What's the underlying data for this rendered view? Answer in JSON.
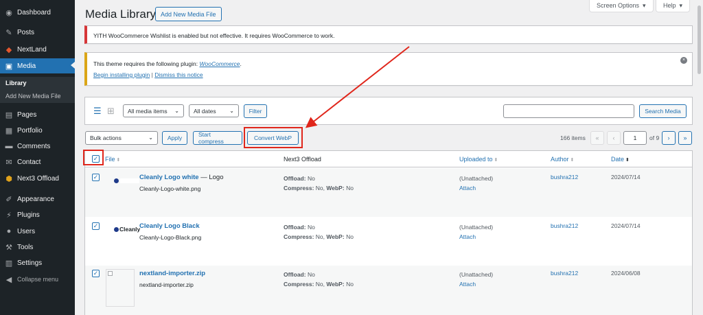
{
  "sidebar": {
    "items": [
      {
        "label": "Dashboard",
        "icon": "dashboard-icon"
      },
      {
        "label": "Posts",
        "icon": "pin-icon"
      },
      {
        "label": "NextLand",
        "icon": "nextland-icon"
      },
      {
        "label": "Media",
        "icon": "media-icon"
      },
      {
        "label": "Pages",
        "icon": "pages-icon"
      },
      {
        "label": "Portfolio",
        "icon": "portfolio-icon"
      },
      {
        "label": "Comments",
        "icon": "comments-icon"
      },
      {
        "label": "Contact",
        "icon": "mail-icon"
      },
      {
        "label": "Next3 Offload",
        "icon": "next3-icon"
      },
      {
        "label": "Appearance",
        "icon": "brush-icon"
      },
      {
        "label": "Plugins",
        "icon": "plugin-icon"
      },
      {
        "label": "Users",
        "icon": "users-icon"
      },
      {
        "label": "Tools",
        "icon": "wrench-icon"
      },
      {
        "label": "Settings",
        "icon": "settings-icon"
      },
      {
        "label": "Collapse menu",
        "icon": "collapse-icon"
      }
    ],
    "submenu": [
      "Library",
      "Add New Media File"
    ]
  },
  "header": {
    "title": "Media Library",
    "add_new": "Add New Media File",
    "screen_options": "Screen Options",
    "help": "Help"
  },
  "notices": {
    "error_text": "YITH WooCommerce Wishlist is enabled but not effective. It requires WooCommerce to work.",
    "warning_prefix": "This theme requires the following plugin: ",
    "warning_plugin": "WooCommerce",
    "warning_suffix": ".",
    "begin_install": "Begin installing plugin",
    "separator": "|",
    "dismiss": "Dismiss this notice"
  },
  "filters": {
    "media_type": "All media items",
    "dates": "All dates",
    "filter_btn": "Filter",
    "search_btn": "Search Media",
    "search_value": ""
  },
  "bulk": {
    "action": "Bulk actions",
    "apply": "Apply",
    "start_compress": "Start compress",
    "convert_webp": "Convert WebP"
  },
  "pagination": {
    "items_count": "166 items",
    "first": "«",
    "prev": "‹",
    "current_page": "1",
    "of_pages": "of 9",
    "next": "›",
    "last": "»"
  },
  "table": {
    "columns": {
      "file": "File",
      "offload": "Next3 Offload",
      "uploaded_to": "Uploaded to",
      "author": "Author",
      "date": "Date"
    },
    "offload_label": "Offload:",
    "compress_label": "Compress:",
    "webp_label": "WebP:",
    "rows": [
      {
        "title": "Cleanly Logo white",
        "title_suffix": " — Logo",
        "filename": "Cleanly-Logo-white.png",
        "offload": "No",
        "compress": "No,",
        "webp": "No",
        "uploaded": "(Unattached)",
        "attach": "Attach",
        "author": "bushra212",
        "date": "2024/07/14"
      },
      {
        "title": "Cleanly Logo Black",
        "title_suffix": "",
        "filename": "Cleanly-Logo-Black.png",
        "offload": "No",
        "compress": "No,",
        "webp": "No",
        "uploaded": "(Unattached)",
        "attach": "Attach",
        "author": "bushra212",
        "date": "2024/07/14",
        "logo_text": "Cleanly"
      },
      {
        "title": "nextland-importer.zip",
        "title_suffix": "",
        "filename": "nextland-importer.zip",
        "offload": "No",
        "compress": "No,",
        "webp": "No",
        "uploaded": "(Unattached)",
        "attach": "Attach",
        "author": "bushra212",
        "date": "2024/06/08"
      }
    ]
  },
  "colors": {
    "sidebar_bg": "#1d2327",
    "accent": "#2271b1",
    "highlight_red": "#e0261b",
    "error_border": "#d63638",
    "warning_border": "#dba617"
  }
}
